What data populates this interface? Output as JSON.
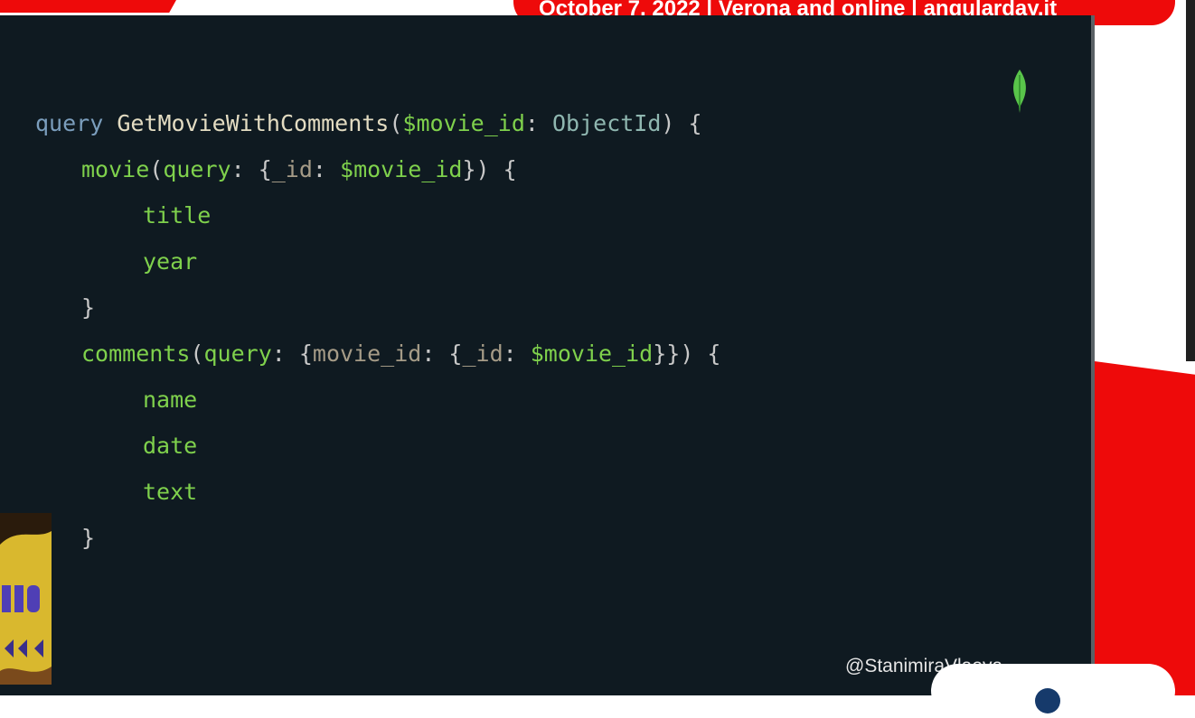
{
  "banner": {
    "text": "October 7, 2022 | Verona and online | angularday.it"
  },
  "slide": {
    "code_lines": [
      [
        {
          "t": "query",
          "c": "kw"
        },
        {
          "t": " ",
          "c": "pu"
        },
        {
          "t": "GetMovieWithComments",
          "c": "fn"
        },
        {
          "t": "(",
          "c": "pu"
        },
        {
          "t": "$movie_id",
          "c": "va"
        },
        {
          "t": ": ",
          "c": "pu"
        },
        {
          "t": "ObjectId",
          "c": "ty"
        },
        {
          "t": ") {",
          "c": "pu"
        }
      ],
      [
        {
          "t": "movie",
          "c": "fi"
        },
        {
          "t": "(",
          "c": "pu"
        },
        {
          "t": "query",
          "c": "fi"
        },
        {
          "t": ": {",
          "c": "pu"
        },
        {
          "t": "_id",
          "c": "arg"
        },
        {
          "t": ": ",
          "c": "pu"
        },
        {
          "t": "$movie_id",
          "c": "va"
        },
        {
          "t": "}) {",
          "c": "pu"
        }
      ],
      [
        {
          "t": "title",
          "c": "fi"
        }
      ],
      [
        {
          "t": "year",
          "c": "fi"
        }
      ],
      [
        {
          "t": "}",
          "c": "pu"
        }
      ],
      [
        {
          "t": "comments",
          "c": "fi"
        },
        {
          "t": "(",
          "c": "pu"
        },
        {
          "t": "query",
          "c": "fi"
        },
        {
          "t": ": {",
          "c": "pu"
        },
        {
          "t": "movie_id",
          "c": "arg"
        },
        {
          "t": ": {",
          "c": "pu"
        },
        {
          "t": "_id",
          "c": "arg"
        },
        {
          "t": ": ",
          "c": "pu"
        },
        {
          "t": "$movie_id",
          "c": "va"
        },
        {
          "t": "}}) {",
          "c": "pu"
        }
      ],
      [
        {
          "t": "name",
          "c": "fi"
        }
      ],
      [
        {
          "t": "date",
          "c": "fi"
        }
      ],
      [
        {
          "t": "text",
          "c": "fi"
        }
      ],
      [
        {
          "t": "}",
          "c": "pu"
        }
      ]
    ],
    "handle": "@StanimiraVlaeva",
    "logo_icon": "mongodb-leaf-icon"
  },
  "colors": {
    "brand_red": "#ee0a0a",
    "slide_bg": "#0f1a21",
    "keyword": "#7b9ebd",
    "field": "#7fd14c",
    "type": "#8fb7b0"
  }
}
